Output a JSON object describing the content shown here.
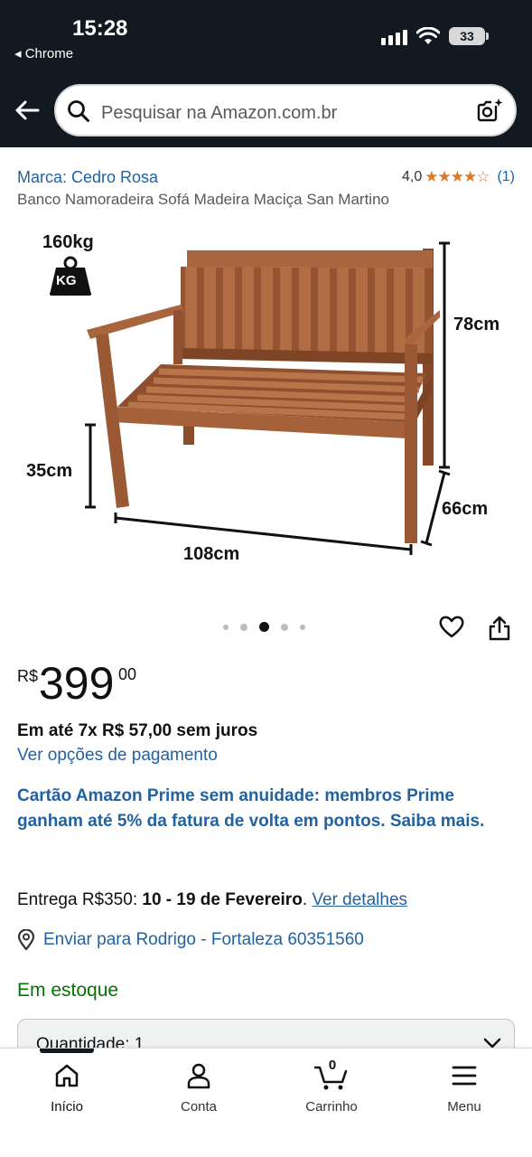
{
  "status_bar": {
    "time": "15:28",
    "back_app": "◂ Chrome",
    "battery": "33"
  },
  "search": {
    "placeholder": "Pesquisar na Amazon.com.br"
  },
  "product": {
    "brand": "Marca: Cedro Rosa",
    "rating": "4,0",
    "rating_stars": 4,
    "rating_count": "(1)",
    "title": "Banco Namoradeira Sofá Madeira Maciça San Martino",
    "image_labels": {
      "weight": "160kg",
      "weight_icon_text": "KG",
      "height": "78cm",
      "seat_height": "35cm",
      "depth": "66cm",
      "width": "108cm"
    },
    "carousel": {
      "count": 5,
      "active_index": 2
    }
  },
  "price": {
    "currency": "R$",
    "integer": "399",
    "cents": "00"
  },
  "installments": "Em até 7x R$ 57,00 sem juros",
  "payment_options_link": "Ver opções de pagamento",
  "promo": "Cartão Amazon Prime sem anuidade: membros Prime ganham até 5% da fatura de volta em pontos. Saiba mais.",
  "delivery": {
    "prefix": "Entrega R$350: ",
    "dates": "10 - 19 de Fevereiro",
    "sep": ". ",
    "link": "Ver detalhes"
  },
  "ship_to": "Enviar para Rodrigo - Fortaleza 60351560",
  "stock": "Em estoque",
  "quantity": "Quantidade: 1",
  "bottom_nav": {
    "home": "Início",
    "account": "Conta",
    "cart": "Carrinho",
    "cart_count": "0",
    "menu": "Menu"
  },
  "colors": {
    "header_bg": "#131921",
    "link_blue": "#2162a1",
    "star_orange": "#de7921",
    "stock_green": "#007600",
    "wood": "#9c5a35"
  }
}
